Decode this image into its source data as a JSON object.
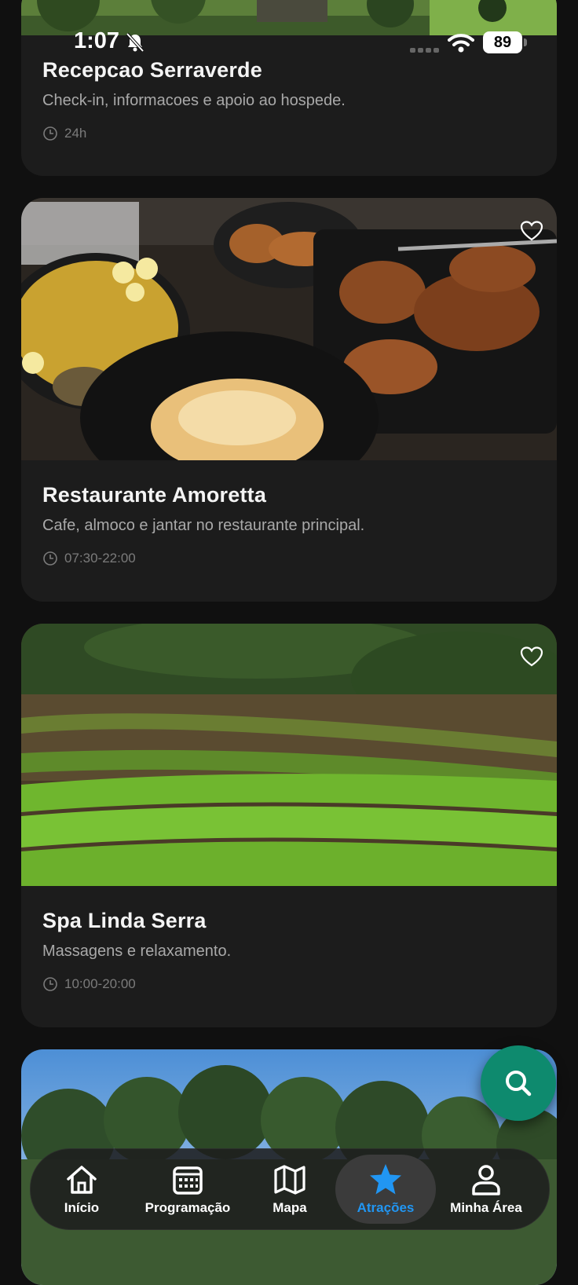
{
  "status_bar": {
    "time": "1:07",
    "battery": "89"
  },
  "cards": [
    {
      "title": "Recepcao Serraverde",
      "description": "Check-in, informacoes e apoio ao hospede.",
      "hours": "24h"
    },
    {
      "title": "Restaurante Amoretta",
      "description": "Cafe, almoco e jantar no restaurante principal.",
      "hours": "07:30-22:00"
    },
    {
      "title": "Spa Linda Serra",
      "description": "Massagens e relaxamento.",
      "hours": "10:00-20:00"
    }
  ],
  "nav": {
    "items": [
      {
        "label": "Início",
        "icon": "home-icon"
      },
      {
        "label": "Programação",
        "icon": "calendar-icon"
      },
      {
        "label": "Mapa",
        "icon": "map-icon"
      },
      {
        "label": "Atrações",
        "icon": "star-icon",
        "active": true
      },
      {
        "label": "Minha Área",
        "icon": "user-icon"
      }
    ]
  },
  "colors": {
    "accent": "#2196f3",
    "fab": "#0e8a6e",
    "card": "#1c1c1c"
  }
}
